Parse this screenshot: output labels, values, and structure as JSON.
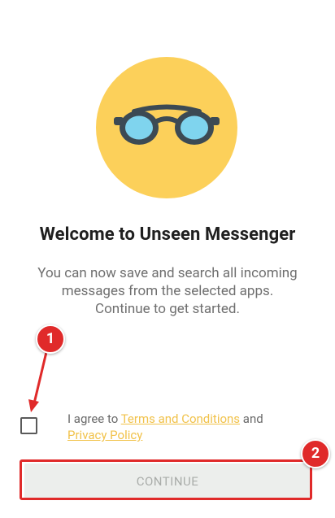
{
  "welcome": {
    "title": "Welcome to Unseen Messenger",
    "description": [
      "You can now save and search all incoming",
      "messages from the selected apps.",
      "Continue to get started."
    ],
    "hero_icon": "sunglasses-icon",
    "accent_color": "#fcd05a"
  },
  "agreement": {
    "prefix": "I agree to ",
    "terms_link": "Terms and Conditions",
    "middle": " and",
    "privacy_link": "Privacy Policy",
    "checked": false
  },
  "actions": {
    "continue_label": "CONTINUE",
    "continue_enabled": false
  },
  "annotations": {
    "badge_1": "1",
    "badge_2": "2",
    "highlight_color": "#e02a2a"
  }
}
